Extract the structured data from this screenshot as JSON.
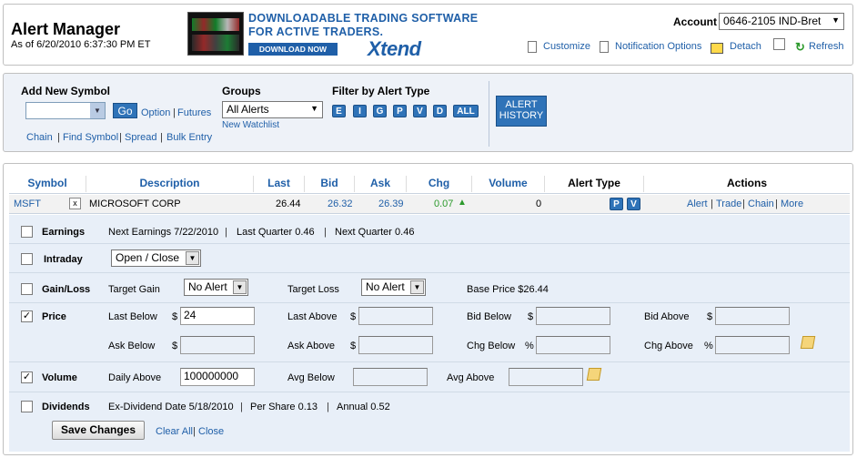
{
  "header": {
    "title": "Alert Manager",
    "asof": "As of 6/20/2010 6:37:30 PM ET",
    "ad": {
      "line1": "DOWNLOADABLE TRADING SOFTWARE",
      "line2": "FOR ACTIVE TRADERS.",
      "button": "DOWNLOAD NOW",
      "brand": "Xtend"
    },
    "account_label": "Account",
    "account_value": "0646-2105 IND-Bret",
    "links": {
      "customize": "Customize",
      "notification": "Notification Options",
      "detach": "Detach",
      "refresh": "Refresh"
    }
  },
  "toolbar": {
    "add_symbol_label": "Add New Symbol",
    "go": "Go",
    "option": "Option",
    "futures": "Futures",
    "chain": "Chain",
    "find_symbol": "Find Symbol",
    "spread": "Spread",
    "bulk_entry": "Bulk Entry",
    "groups_label": "Groups",
    "groups_value": "All Alerts",
    "new_watchlist": "New Watchlist",
    "filter_label": "Filter by Alert Type",
    "filters": [
      "E",
      "I",
      "G",
      "P",
      "V",
      "D",
      "ALL"
    ],
    "alert_history_1": "ALERT",
    "alert_history_2": "HISTORY"
  },
  "table": {
    "headers": {
      "symbol": "Symbol",
      "description": "Description",
      "last": "Last",
      "bid": "Bid",
      "ask": "Ask",
      "chg": "Chg",
      "volume": "Volume",
      "alert_type": "Alert Type",
      "actions": "Actions"
    },
    "row": {
      "symbol": "MSFT",
      "remove": "x",
      "description": "MICROSOFT CORP",
      "last": "26.44",
      "bid": "26.32",
      "ask": "26.39",
      "chg": "0.07",
      "volume": "0",
      "alert_types": [
        "P",
        "V"
      ],
      "actions": [
        "Alert",
        "Trade",
        "Chain",
        "More"
      ]
    }
  },
  "details": {
    "earnings": {
      "label": "Earnings",
      "checked": false,
      "next": "Next Earnings 7/22/2010",
      "last_q": "Last Quarter 0.46",
      "next_q": "Next Quarter 0.46"
    },
    "intraday": {
      "label": "Intraday",
      "checked": false,
      "select": "Open / Close"
    },
    "gainloss": {
      "label": "Gain/Loss",
      "checked": false,
      "target_gain_label": "Target Gain",
      "target_gain": "No Alert",
      "target_loss_label": "Target Loss",
      "target_loss": "No Alert",
      "base_price": "Base Price $26.44"
    },
    "price": {
      "label": "Price",
      "checked": true,
      "last_below_label": "Last Below",
      "last_below": "24",
      "last_above_label": "Last Above",
      "bid_below_label": "Bid Below",
      "bid_above_label": "Bid Above",
      "ask_below_label": "Ask Below",
      "ask_above_label": "Ask Above",
      "chg_below_label": "Chg Below",
      "chg_above_label": "Chg Above",
      "dollar": "$",
      "percent": "%"
    },
    "volume": {
      "label": "Volume",
      "checked": true,
      "daily_above_label": "Daily Above",
      "daily_above": "100000000",
      "avg_below_label": "Avg Below",
      "avg_above_label": "Avg Above"
    },
    "dividends": {
      "label": "Dividends",
      "checked": false,
      "exdiv": "Ex-Dividend Date 5/18/2010",
      "per_share": "Per Share 0.13",
      "annual": "Annual 0.52"
    },
    "save": "Save Changes",
    "clear_all": "Clear All",
    "close": "Close"
  }
}
